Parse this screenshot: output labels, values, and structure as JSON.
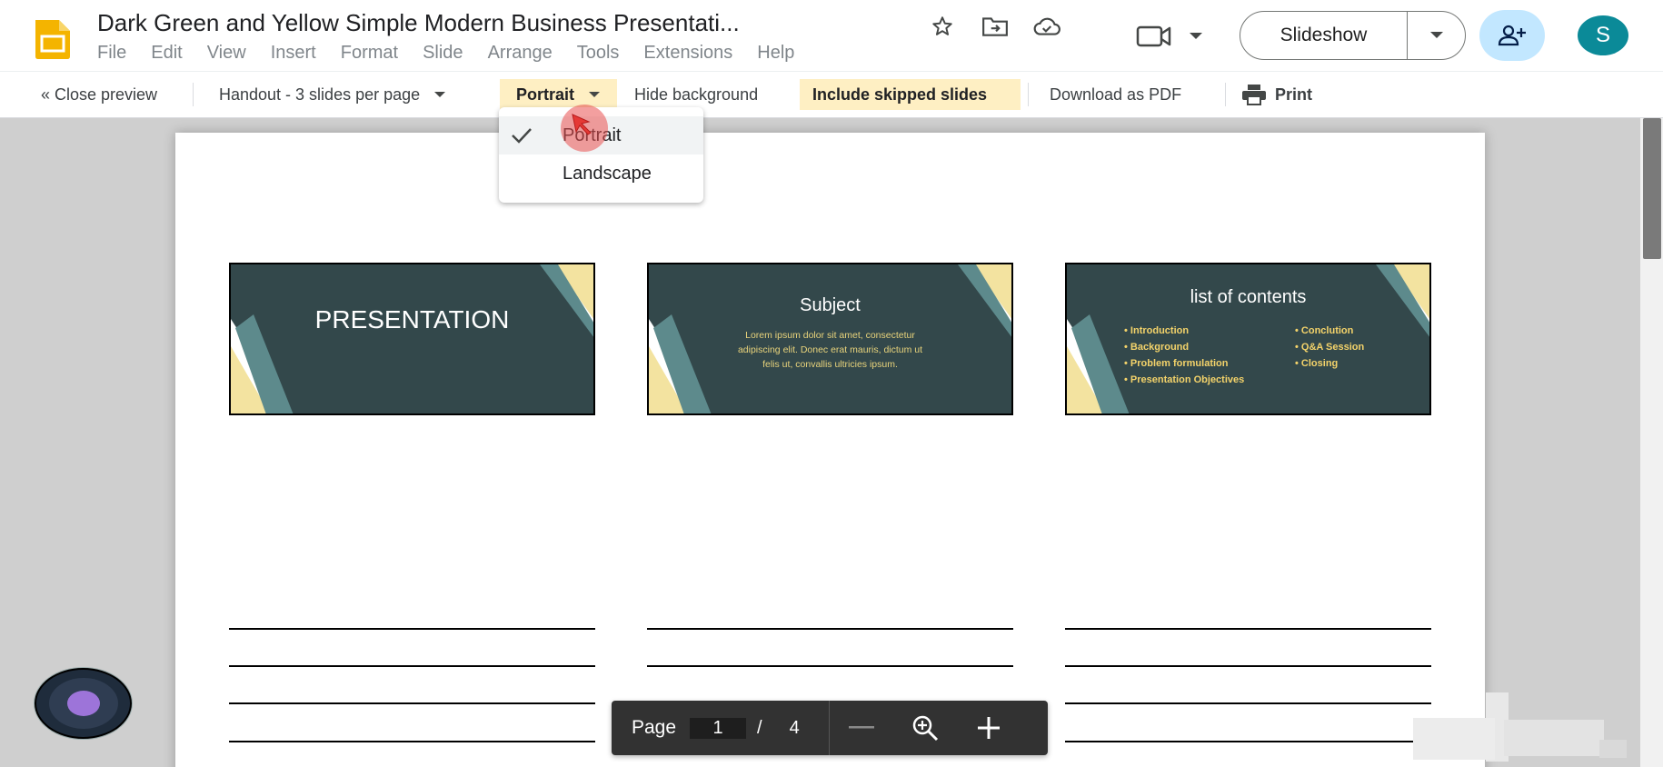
{
  "app": {
    "doc_title": "Dark Green and Yellow Simple Modern Business Presentati...",
    "menu": [
      "File",
      "Edit",
      "View",
      "Insert",
      "Format",
      "Slide",
      "Arrange",
      "Tools",
      "Extensions",
      "Help"
    ],
    "slideshow_label": "Slideshow",
    "avatar_initial": "S"
  },
  "toolbar": {
    "close_preview": "« Close preview",
    "layout": "Handout - 3 slides per page",
    "orientation": "Portrait",
    "hide_background": "Hide background",
    "include_skipped": "Include skipped slides",
    "download_pdf": "Download as PDF",
    "print": "Print"
  },
  "orientation_menu": {
    "options": [
      "Portrait",
      "Landscape"
    ],
    "selected": "Portrait"
  },
  "slides": [
    {
      "title": "PRESENTATION"
    },
    {
      "title": "Subject",
      "body": "Lorem ipsum dolor sit amet, consectetur adipiscing elit. Donec erat mauris, dictum ut felis ut, convallis ultricies ipsum."
    },
    {
      "title": "list of contents",
      "bullets_left": [
        "Introduction",
        "Background",
        "Problem formulation",
        "Presentation Objectives"
      ],
      "bullets_right": [
        "Conclution",
        "Q&A Session",
        "Closing"
      ]
    }
  ],
  "page_nav": {
    "label": "Page",
    "current": "1",
    "separator": "/",
    "total": "4"
  },
  "colors": {
    "slide_bg": "#33484b",
    "accent_yellow": "#f4d36a",
    "highlight": "#feefc3",
    "share_bg": "#c2e7ff",
    "avatar_bg": "#0b8a98"
  },
  "icons": {
    "logo": "google-slides-logo",
    "star": "star-icon",
    "move": "move-to-folder-icon",
    "cloud": "cloud-done-icon",
    "meet": "video-camera-icon",
    "share": "add-person-icon",
    "print": "printer-icon",
    "check": "check-icon",
    "zoom_out": "minus-icon",
    "zoom": "zoom-in-icon",
    "zoom_in": "plus-icon"
  }
}
